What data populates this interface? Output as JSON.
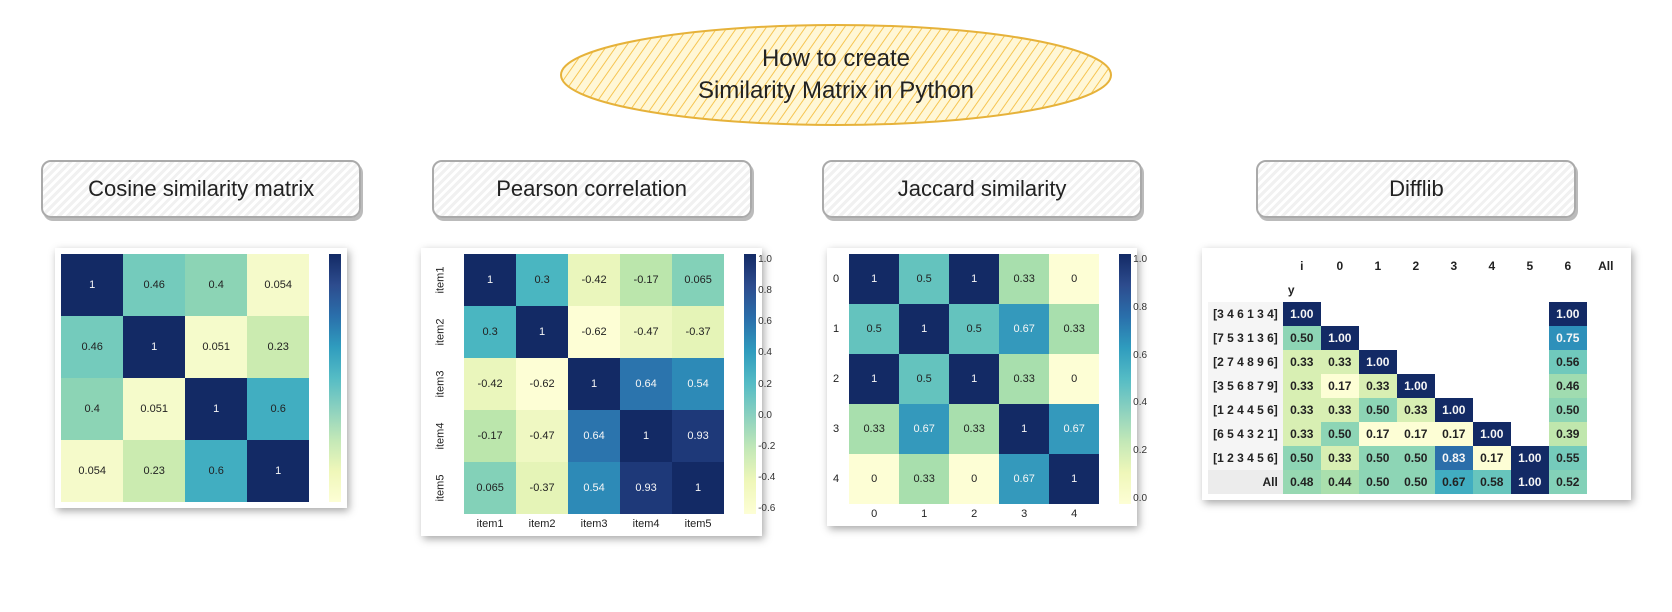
{
  "title": {
    "line1": "How to create",
    "line2": "Similarity Matrix in Python"
  },
  "panels": {
    "cosine": {
      "label": "Cosine similarity matrix"
    },
    "pearson": {
      "label": "Pearson correlation"
    },
    "jaccard": {
      "label": "Jaccard similarity"
    },
    "difflib": {
      "label": "Difflib"
    }
  },
  "chart_data": [
    {
      "type": "heatmap",
      "name": "cosine",
      "title": "Cosine similarity matrix",
      "xlabels": [],
      "ylabels": [],
      "matrix": [
        [
          1,
          0.46,
          0.4,
          0.054
        ],
        [
          0.46,
          1,
          0.051,
          0.23
        ],
        [
          0.4,
          0.051,
          1,
          0.6
        ],
        [
          0.054,
          0.23,
          0.6,
          1
        ]
      ],
      "colorbar_ticks": [],
      "vmin": 0.0,
      "vmax": 1.0
    },
    {
      "type": "heatmap",
      "name": "pearson",
      "title": "Pearson correlation",
      "xlabels": [
        "item1",
        "item2",
        "item3",
        "item4",
        "item5"
      ],
      "ylabels": [
        "item1",
        "item2",
        "item3",
        "item4",
        "item5"
      ],
      "matrix": [
        [
          1,
          0.3,
          -0.42,
          -0.17,
          0.065
        ],
        [
          0.3,
          1,
          -0.62,
          -0.47,
          -0.37
        ],
        [
          -0.42,
          -0.62,
          1,
          0.64,
          0.54
        ],
        [
          -0.17,
          -0.47,
          0.64,
          1,
          0.93
        ],
        [
          0.065,
          -0.37,
          0.54,
          0.93,
          1
        ]
      ],
      "colorbar_ticks": [
        "1.0",
        "0.8",
        "0.6",
        "0.4",
        "0.2",
        "0.0",
        "-0.2",
        "-0.4",
        "-0.6"
      ],
      "vmin": -0.62,
      "vmax": 1.0
    },
    {
      "type": "heatmap",
      "name": "jaccard",
      "title": "Jaccard similarity",
      "xlabels": [
        "0",
        "1",
        "2",
        "3",
        "4"
      ],
      "ylabels": [
        "0",
        "1",
        "2",
        "3",
        "4"
      ],
      "matrix": [
        [
          1,
          0.5,
          1,
          0.33,
          0
        ],
        [
          0.5,
          1,
          0.5,
          0.67,
          0.33
        ],
        [
          1,
          0.5,
          1,
          0.33,
          0
        ],
        [
          0.33,
          0.67,
          0.33,
          1,
          0.67
        ],
        [
          0,
          0.33,
          0,
          0.67,
          1
        ]
      ],
      "colorbar_ticks": [
        "1.0",
        "0.8",
        "0.6",
        "0.4",
        "0.2",
        "0.0"
      ],
      "vmin": 0.0,
      "vmax": 1.0
    },
    {
      "type": "table",
      "name": "difflib",
      "title": "Difflib",
      "top_header": [
        "i",
        "0",
        "1",
        "2",
        "3",
        "4",
        "5",
        "6",
        "All"
      ],
      "second_header": "y",
      "rows": [
        {
          "label": "[3 4 6 1 3 4]",
          "cells": [
            "1.00",
            null,
            null,
            null,
            null,
            null,
            null,
            "1.00"
          ]
        },
        {
          "label": "[7 5 3 1 3 6]",
          "cells": [
            "0.50",
            "1.00",
            null,
            null,
            null,
            null,
            null,
            "0.75"
          ]
        },
        {
          "label": "[2 7 4 8 9 6]",
          "cells": [
            "0.33",
            "0.33",
            "1.00",
            null,
            null,
            null,
            null,
            "0.56"
          ]
        },
        {
          "label": "[3 5 6 8 7 9]",
          "cells": [
            "0.33",
            "0.17",
            "0.33",
            "1.00",
            null,
            null,
            null,
            "0.46"
          ]
        },
        {
          "label": "[1 2 4 4 5 6]",
          "cells": [
            "0.33",
            "0.33",
            "0.50",
            "0.33",
            "1.00",
            null,
            null,
            "0.50"
          ]
        },
        {
          "label": "[6 5 4 3 2 1]",
          "cells": [
            "0.33",
            "0.50",
            "0.17",
            "0.17",
            "0.17",
            "1.00",
            null,
            "0.39"
          ]
        },
        {
          "label": "[1 2 3 4 5 6]",
          "cells": [
            "0.50",
            "0.33",
            "0.50",
            "0.50",
            "0.83",
            "0.17",
            "1.00",
            "0.55"
          ]
        },
        {
          "label": "All",
          "cells": [
            "0.48",
            "0.44",
            "0.50",
            "0.50",
            "0.67",
            "0.58",
            "1.00",
            "0.52"
          ]
        }
      ],
      "vmin": 0.17,
      "vmax": 1.0
    }
  ]
}
